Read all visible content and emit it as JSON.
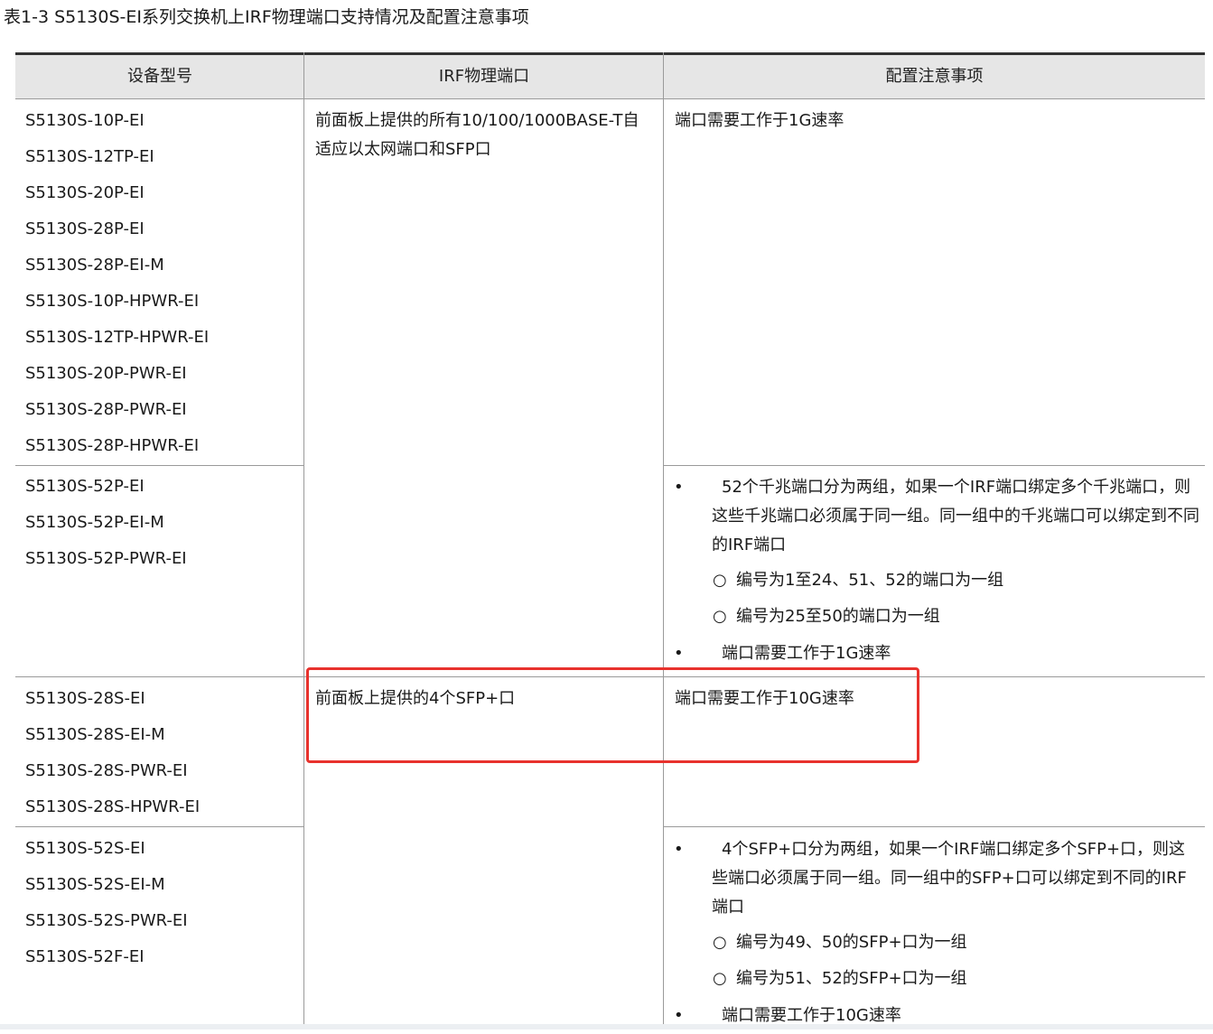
{
  "caption": "表1-3 S5130S-EI系列交换机上IRF物理端口支持情况及配置注意事项",
  "headers": [
    "设备型号",
    "IRF物理端口",
    "配置注意事项"
  ],
  "rows": [
    {
      "models": [
        "S5130S-10P-EI",
        "S5130S-12TP-EI",
        "S5130S-20P-EI",
        "S5130S-28P-EI",
        "S5130S-28P-EI-M",
        "S5130S-10P-HPWR-EI",
        "S5130S-12TP-HPWR-EI",
        "S5130S-20P-PWR-EI",
        "S5130S-28P-PWR-EI",
        "S5130S-28P-HPWR-EI"
      ],
      "port": "前面板上提供的所有10/100/1000BASE-T自适应以太网端口和SFP口",
      "note": "端口需要工作于1G速率"
    },
    {
      "models": [
        "S5130S-52P-EI",
        "S5130S-52P-EI-M",
        "S5130S-52P-PWR-EI"
      ],
      "bullets": [
        {
          "symbol": "•",
          "text": "52个千兆端口分为两组，如果一个IRF端口绑定多个千兆端口，则这些千兆端口必须属于同一组。同一组中的千兆端口可以绑定到不同的IRF端口"
        },
        {
          "symbol": "•",
          "text": "端口需要工作于1G速率"
        }
      ],
      "subs": [
        {
          "symbol": "○",
          "text": "编号为1至24、51、52的端口为一组"
        },
        {
          "symbol": "○",
          "text": "编号为25至50的端口为一组"
        }
      ]
    },
    {
      "models": [
        "S5130S-28S-EI",
        "S5130S-28S-EI-M",
        "S5130S-28S-PWR-EI",
        "S5130S-28S-HPWR-EI"
      ],
      "port": "前面板上提供的4个SFP+口",
      "note": "端口需要工作于10G速率"
    },
    {
      "models": [
        "S5130S-52S-EI",
        "S5130S-52S-EI-M",
        "S5130S-52S-PWR-EI",
        "S5130S-52F-EI"
      ],
      "bullets": [
        {
          "symbol": "•",
          "text": "4个SFP+口分为两组，如果一个IRF端口绑定多个SFP+口，则这些端口必须属于同一组。同一组中的SFP+口可以绑定到不同的IRF端口"
        },
        {
          "symbol": "•",
          "text": "端口需要工作于10G速率"
        }
      ],
      "subs": [
        {
          "symbol": "○",
          "text": "编号为49、50的SFP+口为一组"
        },
        {
          "symbol": "○",
          "text": "编号为51、52的SFP+口为一组"
        }
      ]
    }
  ],
  "highlight_color": "#e8322d"
}
